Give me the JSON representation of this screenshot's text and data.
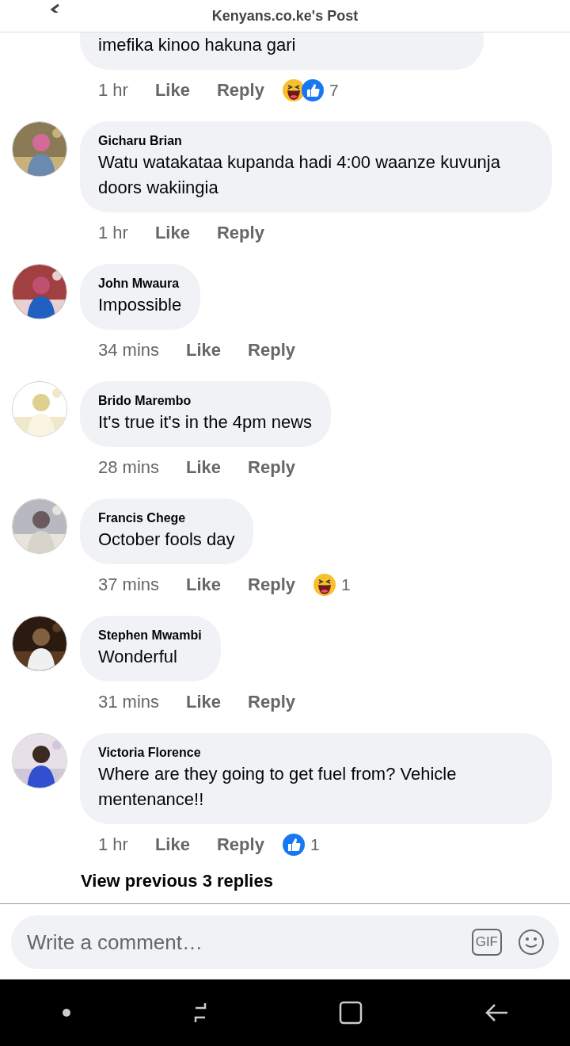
{
  "header": {
    "title": "Kenyans.co.ke's Post"
  },
  "comments": [
    {
      "text": "imefika kinoo hakuna gari",
      "time": "1 hr",
      "like": "Like",
      "reply": "Reply",
      "reactions": [
        {
          "kind": "haha"
        },
        {
          "kind": "like"
        }
      ],
      "reaction_count": "7"
    },
    {
      "author": "Gicharu Brian",
      "avatar": {
        "kind": "picture"
      },
      "text": "Watu watakataa kupanda hadi 4:00 waanze kuvunja doors wakiingia",
      "time": "1 hr",
      "like": "Like",
      "reply": "Reply"
    },
    {
      "author": "John Mwaura",
      "avatar": {
        "kind": "picture"
      },
      "text": "Impossible",
      "time": "34 mins",
      "like": "Like",
      "reply": "Reply"
    },
    {
      "author": "Brido Marembo",
      "avatar": {
        "kind": "picture"
      },
      "text": "It's true it's in the 4pm news",
      "time": "28 mins",
      "like": "Like",
      "reply": "Reply"
    },
    {
      "author": "Francis Chege",
      "avatar": {
        "kind": "picture"
      },
      "text": "October fools day",
      "time": "37 mins",
      "like": "Like",
      "reply": "Reply",
      "reactions": [
        {
          "kind": "haha"
        }
      ],
      "reaction_count": "1"
    },
    {
      "author": "Stephen Mwambi",
      "avatar": {
        "kind": "picture"
      },
      "text": "Wonderful",
      "time": "31 mins",
      "like": "Like",
      "reply": "Reply"
    },
    {
      "author": "Victoria Florence",
      "avatar": {
        "kind": "picture"
      },
      "text": "Where are they going to get fuel from? Vehicle mentenance!!",
      "time": "1 hr",
      "like": "Like",
      "reply": "Reply",
      "reactions": [
        {
          "kind": "like"
        }
      ],
      "reaction_count": "1"
    }
  ],
  "view_previous": "View previous 3 replies",
  "composer": {
    "placeholder": "Write a comment…",
    "gif": "GIF"
  }
}
